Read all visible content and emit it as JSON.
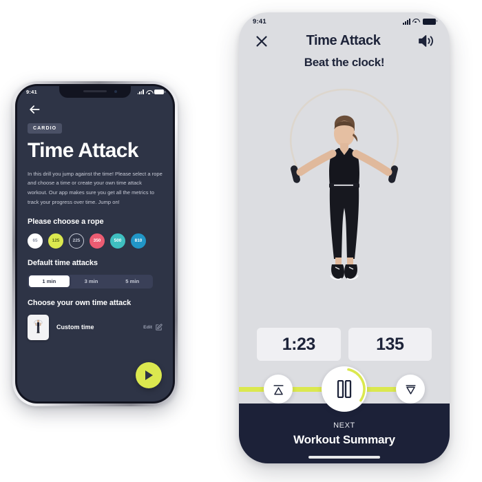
{
  "left_phone": {
    "status_bar": {
      "time": "9:41",
      "signal_icon": "cellular-bars-icon",
      "wifi_icon": "wifi-icon",
      "battery_icon": "battery-icon"
    },
    "back_icon": "back-arrow-icon",
    "badge": "CARDIO",
    "title": "Time Attack",
    "description": "In this drill you jump against the time! Please select a rope and choose a time or create your own time attack workout. Our app makes sure you get all the metrics to track your progress over time. Jump on!",
    "rope_section_title": "Please choose a rope",
    "ropes": [
      {
        "label": "65",
        "bg": "#ffffff",
        "fg": "#7e8496",
        "border": "#ffffff"
      },
      {
        "label": "125",
        "bg": "#dbe84f",
        "fg": "#5d6a16",
        "border": "#dbe84f"
      },
      {
        "label": "225",
        "bg": "#2e3446",
        "fg": "#c8ccd8",
        "border": "#c8ccd8"
      },
      {
        "label": "350",
        "bg": "#ec5c72",
        "fg": "#ffffff",
        "border": "#ec5c72"
      },
      {
        "label": "500",
        "bg": "#3fbfc0",
        "fg": "#ffffff",
        "border": "#3fbfc0"
      },
      {
        "label": "810",
        "bg": "#2196c7",
        "fg": "#ffffff",
        "border": "#2196c7"
      }
    ],
    "default_section_title": "Default time attacks",
    "time_options": [
      {
        "label": "1 min",
        "selected": true
      },
      {
        "label": "3 min",
        "selected": false
      },
      {
        "label": "5 min",
        "selected": false
      }
    ],
    "custom_section_title": "Choose your own time attack",
    "custom_row": {
      "thumbnail_icon": "jumper-thumbnail-icon",
      "label": "Custom time",
      "edit_label": "Edit",
      "edit_icon": "edit-pencil-icon"
    },
    "play_button_icon": "play-icon",
    "accent_color": "#dbe84f",
    "background_color": "#2e3446"
  },
  "right_phone": {
    "status_bar": {
      "time": "9:41",
      "signal_icon": "cellular-bars-icon",
      "wifi_icon": "wifi-icon",
      "battery_icon": "battery-icon"
    },
    "close_icon": "close-x-icon",
    "title": "Time Attack",
    "sound_icon": "speaker-volume-icon",
    "subtitle": "Beat the clock!",
    "hero_image": "woman-jumping-rope-photo",
    "stats": [
      {
        "name": "elapsed-time",
        "value": "1:23"
      },
      {
        "name": "jump-count",
        "value": "135"
      }
    ],
    "controls": {
      "rewind_icon": "skip-to-start-icon",
      "pause_icon": "pause-icon",
      "forward_icon": "skip-to-end-icon",
      "progress_percent": 72,
      "progress_color": "#dbe84f"
    },
    "footer": {
      "next_label": "NEXT",
      "next_title": "Workout Summary"
    },
    "background_color": "#dcdde1",
    "footer_color": "#1c2138"
  }
}
